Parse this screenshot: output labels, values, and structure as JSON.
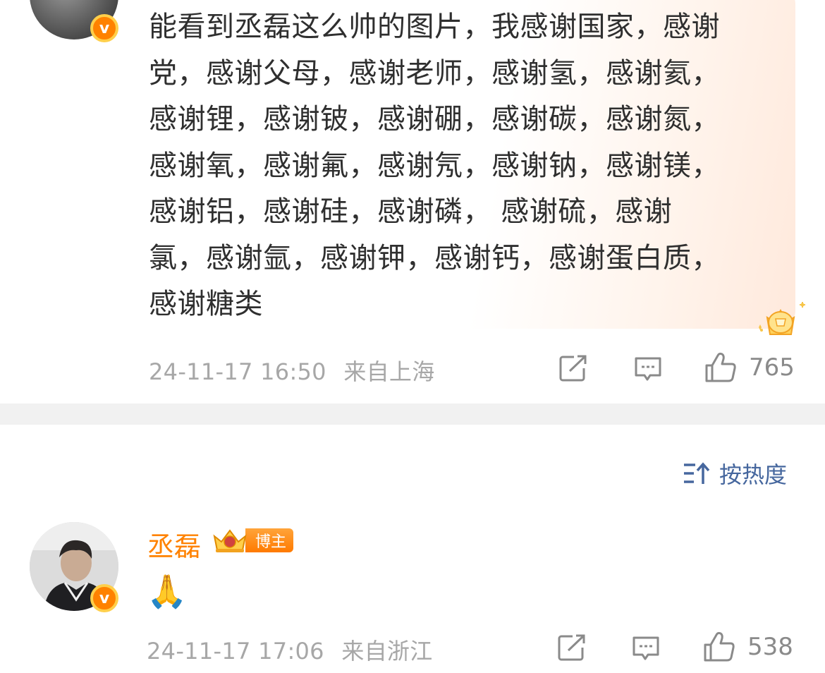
{
  "post": {
    "text_lines": [
      "能看到丞磊这么帅的图片，我感谢国家，感谢",
      "党，感谢父母，感谢老师，感谢氢，感谢氦，",
      "感谢锂，感谢铍，感谢硼，感谢碳，感谢氮，",
      "感谢氧，感谢氟，感谢氖，感谢钠，感谢镁，",
      "感谢铝，感谢硅，感谢磷， 感谢硫，感谢",
      "氯，感谢氩，感谢钾，感谢钙，感谢蛋白质，",
      "感谢糖类"
    ],
    "timestamp": "24-11-17 16:50",
    "location": "来自上海",
    "like_count": "765",
    "verified_badge": "v"
  },
  "sort": {
    "label": "按热度",
    "icon": "sort-icon"
  },
  "reply": {
    "username": "丞磊",
    "badge_label": "博主",
    "content": "🙏",
    "timestamp": "24-11-17 17:06",
    "location": "来自浙江",
    "like_count": "538",
    "verified_badge": "v"
  },
  "colors": {
    "accent_orange": "#ff8200",
    "text_dark": "#2f2f2f",
    "meta_gray": "#a7a7a7",
    "sort_blue": "#46679e",
    "divider": "#f1f1f1"
  },
  "icons": [
    "share-icon",
    "comment-icon",
    "like-icon",
    "crown-badge-icon",
    "sort-icon"
  ]
}
